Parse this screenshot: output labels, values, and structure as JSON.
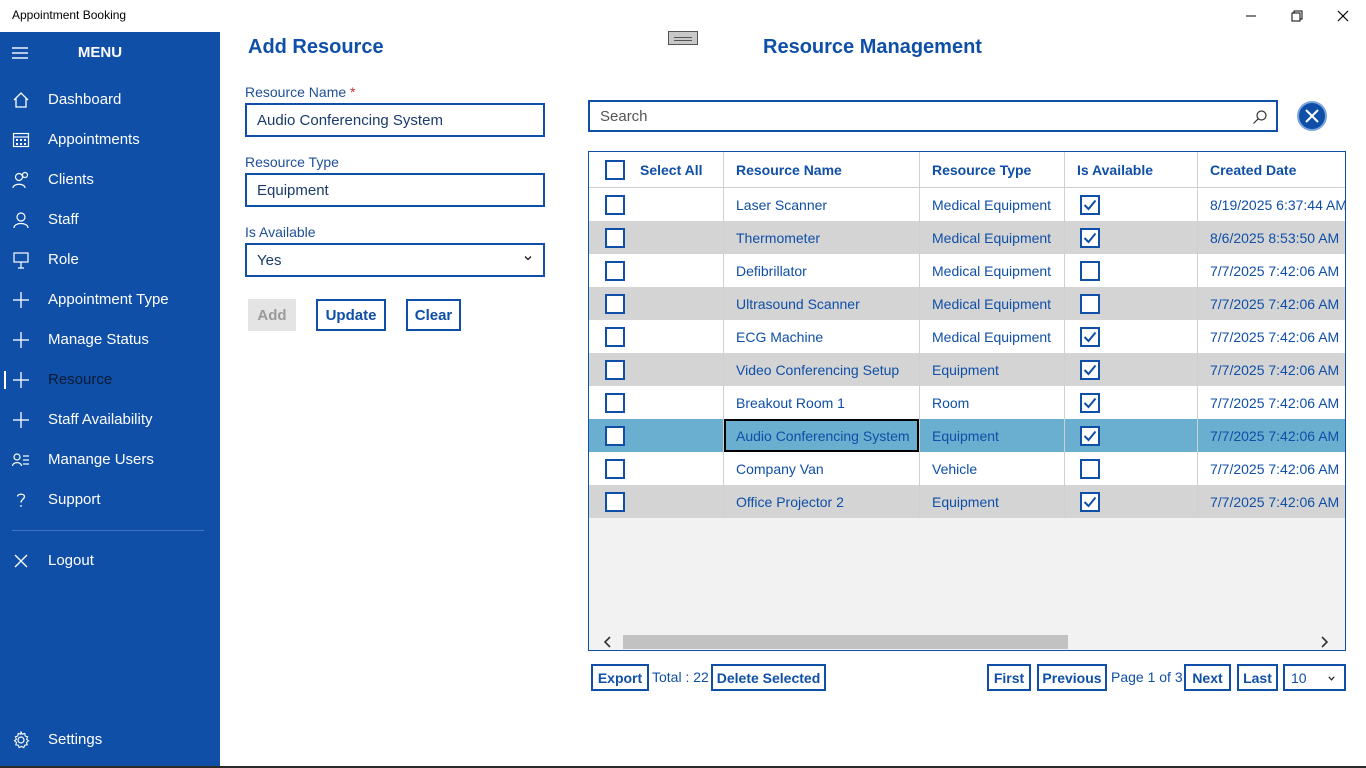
{
  "window": {
    "title": "Appointment Booking"
  },
  "sidebar": {
    "menu_title": "MENU",
    "items": [
      {
        "label": "Dashboard",
        "icon": "home-icon"
      },
      {
        "label": "Appointments",
        "icon": "calendar-icon"
      },
      {
        "label": "Clients",
        "icon": "people-icon"
      },
      {
        "label": "Staff",
        "icon": "person-icon"
      },
      {
        "label": "Role",
        "icon": "presenter-icon"
      },
      {
        "label": "Appointment Type",
        "icon": "plus-icon"
      },
      {
        "label": "Manage Status",
        "icon": "plus-icon"
      },
      {
        "label": "Resource",
        "icon": "plus-icon",
        "active": true
      },
      {
        "label": "Staff Availability",
        "icon": "plus-icon"
      },
      {
        "label": "Manange Users",
        "icon": "user-list-icon"
      },
      {
        "label": "Support",
        "icon": "question-icon"
      }
    ],
    "logout_label": "Logout",
    "settings_label": "Settings"
  },
  "form": {
    "title": "Add Resource",
    "resource_name_label": "Resource Name",
    "required_mark": "*",
    "resource_name_value": "Audio Conferencing System",
    "resource_type_label": "Resource Type",
    "resource_type_value": "Equipment",
    "is_available_label": "Is Available",
    "is_available_value": "Yes",
    "add_label": "Add",
    "update_label": "Update",
    "clear_label": "Clear"
  },
  "management": {
    "title": "Resource Management",
    "search_placeholder": "Search"
  },
  "grid": {
    "headers": {
      "select_all": "Select All",
      "resource_name": "Resource Name",
      "resource_type": "Resource Type",
      "is_available": "Is Available",
      "created_date": "Created Date"
    },
    "rows": [
      {
        "name": "Laser Scanner",
        "type": "Medical Equipment",
        "available": true,
        "created": "8/19/2025 6:37:44 AM"
      },
      {
        "name": "Thermometer",
        "type": "Medical Equipment",
        "available": true,
        "created": "8/6/2025 8:53:50 AM"
      },
      {
        "name": "Defibrillator",
        "type": "Medical Equipment",
        "available": false,
        "created": "7/7/2025 7:42:06 AM"
      },
      {
        "name": "Ultrasound Scanner",
        "type": "Medical Equipment",
        "available": false,
        "created": "7/7/2025 7:42:06 AM"
      },
      {
        "name": "ECG Machine",
        "type": "Medical Equipment",
        "available": true,
        "created": "7/7/2025 7:42:06 AM"
      },
      {
        "name": "Video Conferencing Setup",
        "type": "Equipment",
        "available": true,
        "created": "7/7/2025 7:42:06 AM"
      },
      {
        "name": "Breakout Room 1",
        "type": "Room",
        "available": true,
        "created": "7/7/2025 7:42:06 AM"
      },
      {
        "name": "Audio Conferencing System",
        "type": "Equipment",
        "available": true,
        "created": "7/7/2025 7:42:06 AM",
        "selected": true
      },
      {
        "name": "Company Van",
        "type": "Vehicle",
        "available": false,
        "created": "7/7/2025 7:42:06 AM"
      },
      {
        "name": "Office Projector 2",
        "type": "Equipment",
        "available": true,
        "created": "7/7/2025 7:42:06 AM"
      }
    ]
  },
  "footer": {
    "export_label": "Export",
    "total_text": "Total : 22",
    "delete_selected_label": "Delete Selected",
    "first_label": "First",
    "previous_label": "Previous",
    "page_text": "Page 1 of 3",
    "next_label": "Next",
    "last_label": "Last",
    "page_size": "10"
  },
  "colors": {
    "accent": "#0f4fa8",
    "selected_row": "#6aaed0",
    "alt_row": "#d4d4d4"
  }
}
